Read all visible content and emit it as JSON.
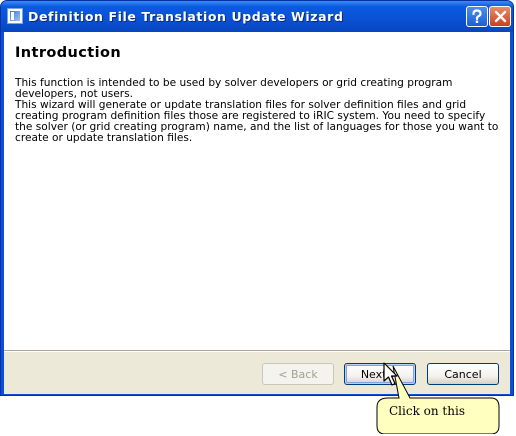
{
  "window": {
    "title": "Definition File Translation Update Wizard",
    "icons": {
      "app": "iric-app-icon",
      "help": "help-icon",
      "close": "close-icon"
    }
  },
  "page": {
    "heading": "Introduction",
    "paragraphs": [
      "This function is intended to be used by solver developers or grid creating program",
      "developers, not users.",
      "This wizard will generate or update translation files for solver definition files and grid",
      "creating program definition files those are registered to iRIC system. You need to specify",
      "the solver (or grid creating program) name, and the list of languages for those you want to",
      "create or update translation files."
    ]
  },
  "buttons": {
    "back": {
      "text": "< Back",
      "enabled": false
    },
    "next": {
      "text": "Next >",
      "focused": true
    },
    "cancel": {
      "text": "Cancel"
    }
  },
  "annotation": {
    "callout_text": "Click on this",
    "callout_color": "#ffffc0",
    "cursor": "pointer-arrow-icon"
  },
  "colors": {
    "titlebar": "#0a52d6",
    "dialog_background": "#ece9d8",
    "close_button": "#c9411e"
  }
}
